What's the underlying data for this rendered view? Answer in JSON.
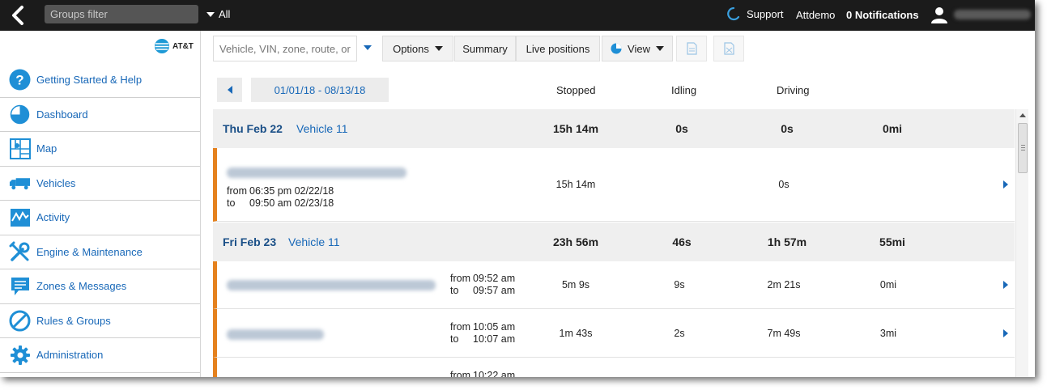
{
  "topbar": {
    "groups_filter_placeholder": "Groups filter",
    "all_label": "All",
    "support_label": "Support",
    "user_label": "Attdemo",
    "notifications_label": "0 Notifications"
  },
  "sidebar": {
    "brand_text": "AT&T",
    "items": [
      {
        "label": "Getting Started & Help",
        "icon": "help-icon"
      },
      {
        "label": "Dashboard",
        "icon": "pie-chart-icon"
      },
      {
        "label": "Map",
        "icon": "map-icon"
      },
      {
        "label": "Vehicles",
        "icon": "truck-icon"
      },
      {
        "label": "Activity",
        "icon": "activity-icon"
      },
      {
        "label": "Engine & Maintenance",
        "icon": "wrench-icon"
      },
      {
        "label": "Zones & Messages",
        "icon": "message-icon"
      },
      {
        "label": "Rules & Groups",
        "icon": "rules-icon"
      },
      {
        "label": "Administration",
        "icon": "gear-icon"
      }
    ]
  },
  "toolbar": {
    "search_placeholder": "Vehicle, VIN, zone, route, or",
    "options_label": "Options",
    "summary_label": "Summary",
    "live_positions_label": "Live positions",
    "view_label": "View"
  },
  "report": {
    "date_range": "01/01/18 - 08/13/18",
    "columns": [
      "Stopped",
      "Idling",
      "Driving"
    ],
    "days": [
      {
        "date": "Thu Feb 22",
        "vehicle": "Vehicle 11",
        "stopped": "15h 14m",
        "idling": "0s",
        "driving": "0s",
        "distance": "0mi",
        "trips": [
          {
            "from_label": "from",
            "from_time": "06:35 pm 02/22/18",
            "to_label": "to",
            "to_time": "09:50 am 02/23/18",
            "stopped": "15h 14m",
            "driving": "0s"
          }
        ]
      },
      {
        "date": "Fri Feb 23",
        "vehicle": "Vehicle 11",
        "stopped": "23h 56m",
        "idling": "46s",
        "driving": "1h 57m",
        "distance": "55mi",
        "trips": [
          {
            "from_label": "from",
            "from_time": "09:52 am",
            "to_label": "to",
            "to_time": "09:57 am",
            "stopped": "5m 9s",
            "idling": "9s",
            "driving": "2m 21s",
            "distance": "0mi"
          },
          {
            "from_label": "from",
            "from_time": "10:05 am",
            "to_label": "to",
            "to_time": "10:07 am",
            "stopped": "1m 43s",
            "idling": "2s",
            "driving": "7m 49s",
            "distance": "3mi"
          },
          {
            "from_label": "from",
            "from_time": "10:22 am"
          }
        ]
      }
    ]
  },
  "colors": {
    "topbar_bg": "#1b1b1b",
    "link_blue": "#1868b8",
    "trip_accent": "#e5811e",
    "day_row_bg": "#efefef"
  }
}
